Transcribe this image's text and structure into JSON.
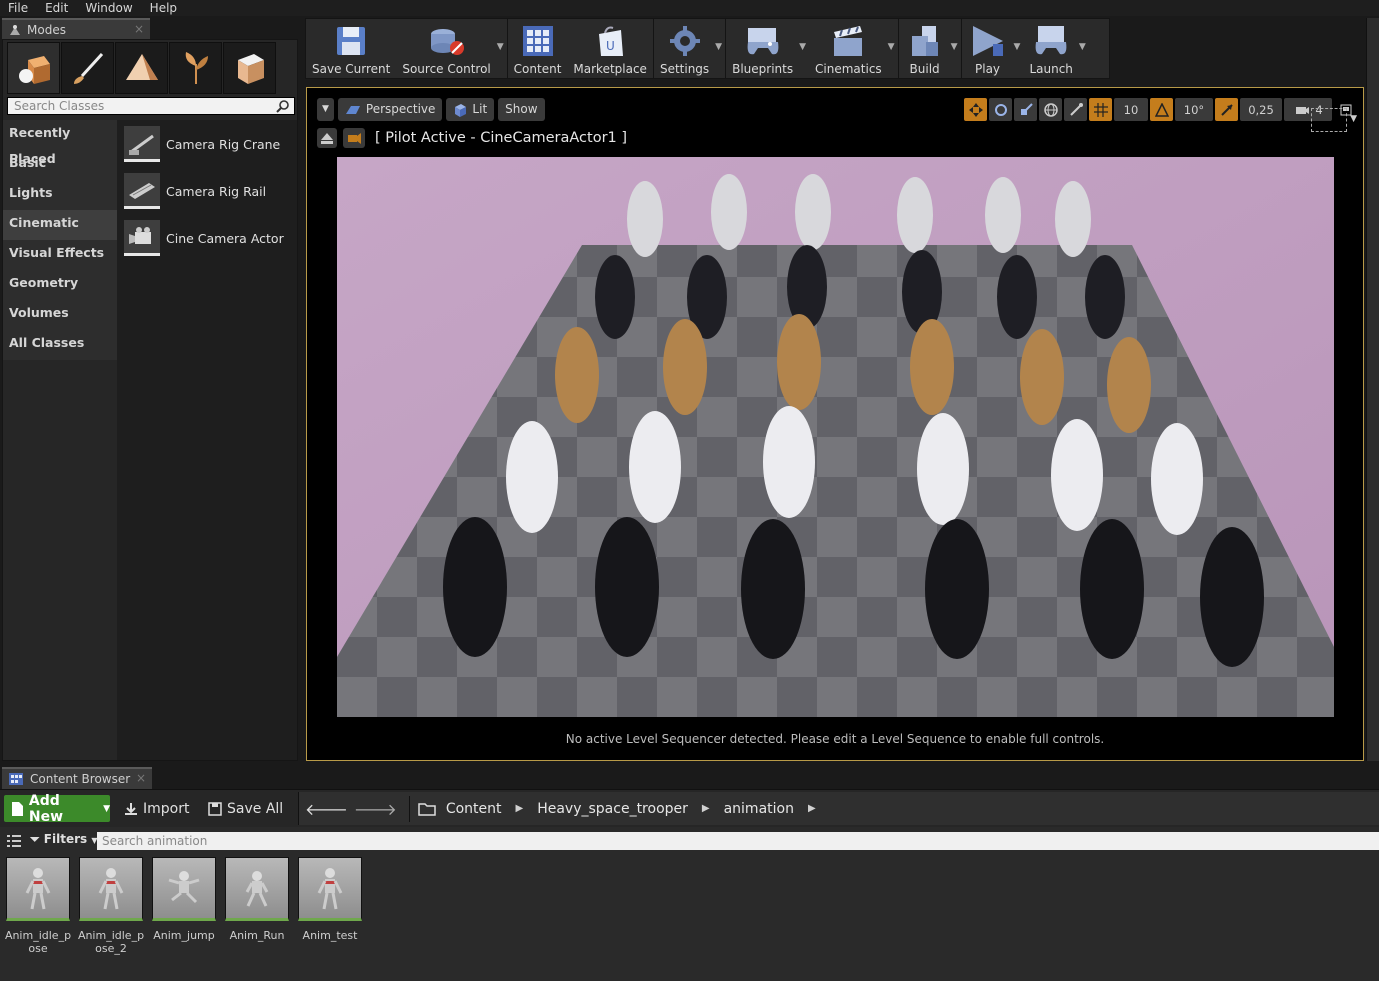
{
  "menu": [
    "File",
    "Edit",
    "Window",
    "Help"
  ],
  "modes": {
    "tab_title": "Modes",
    "search_placeholder": "Search Classes",
    "categories": [
      "Recently Placed",
      "Basic",
      "Lights",
      "Cinematic",
      "Visual Effects",
      "Geometry",
      "Volumes",
      "All Classes"
    ],
    "active_category": "Cinematic",
    "items": [
      "Camera Rig Crane",
      "Camera Rig Rail",
      "Cine Camera Actor"
    ]
  },
  "toolbar": {
    "buttons": [
      "Save Current",
      "Source Control",
      "Content",
      "Marketplace",
      "Settings",
      "Blueprints",
      "Cinematics",
      "Build",
      "Play",
      "Launch"
    ]
  },
  "viewport": {
    "view_mode": "Perspective",
    "lighting": "Lit",
    "show": "Show",
    "grid_snap": "10",
    "rotation_snap": "10°",
    "scale_snap": "0,25",
    "camera_speed": "4",
    "pilot_label": "[ Pilot Active - CineCameraActor1 ]",
    "sequencer_message": "No active Level Sequencer detected. Please edit a Level Sequence to enable full controls."
  },
  "content_browser": {
    "tab_title": "Content Browser",
    "add_new": "Add New",
    "import": "Import",
    "save_all": "Save All",
    "path": [
      "Content",
      "Heavy_space_trooper",
      "animation"
    ],
    "filters": "Filters",
    "search_placeholder": "Search animation",
    "assets": [
      "Anim_idle_pose",
      "Anim_idle_pose_2",
      "Anim_jump",
      "Anim_Run",
      "Anim_test"
    ]
  },
  "colors": {
    "accent_orange": "#c47d1c",
    "add_new_green": "#3c8a2a",
    "viewport_border": "#b89a48"
  }
}
